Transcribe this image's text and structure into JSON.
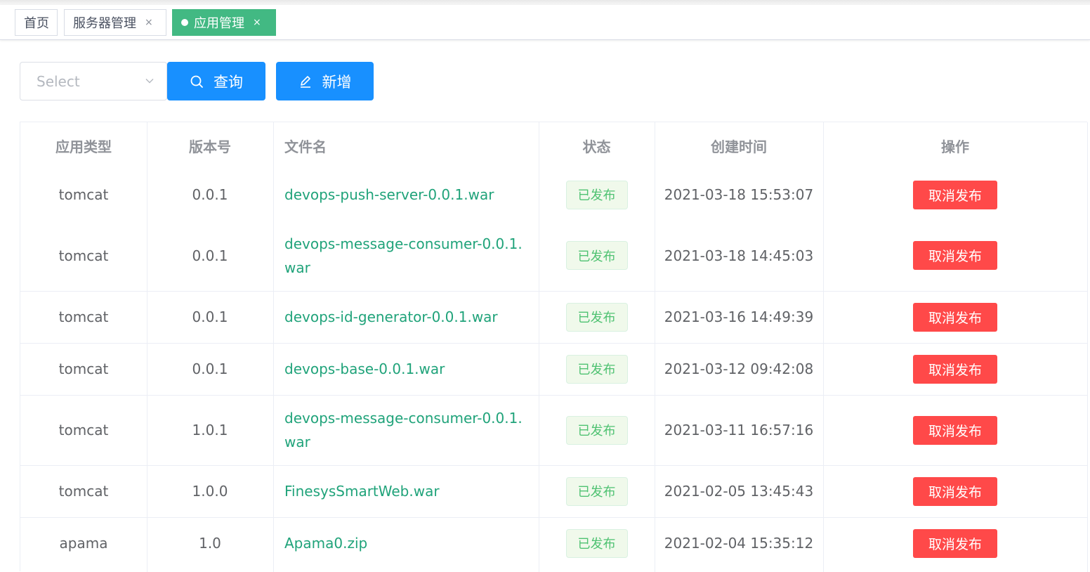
{
  "tags": [
    {
      "label": "首页",
      "closable": false,
      "active": false
    },
    {
      "label": "服务器管理",
      "closable": true,
      "active": false
    },
    {
      "label": "应用管理",
      "closable": true,
      "active": true
    }
  ],
  "close_glyph": "×",
  "toolbar": {
    "select_placeholder": "Select",
    "search_label": "查询",
    "add_label": "新增"
  },
  "table": {
    "headers": {
      "type": "应用类型",
      "version": "版本号",
      "filename": "文件名",
      "status": "状态",
      "created": "创建时间",
      "action": "操作"
    },
    "rows": [
      {
        "type": "tomcat",
        "version": "0.0.1",
        "filename": "devops-push-server-0.0.1.war",
        "status": "已发布",
        "created": "2021-03-18 15:53:07",
        "action": "取消发布"
      },
      {
        "type": "tomcat",
        "version": "0.0.1",
        "filename": "devops-message-consumer-0.0.1.war",
        "status": "已发布",
        "created": "2021-03-18 14:45:03",
        "action": "取消发布"
      },
      {
        "type": "tomcat",
        "version": "0.0.1",
        "filename": "devops-id-generator-0.0.1.war",
        "status": "已发布",
        "created": "2021-03-16 14:49:39",
        "action": "取消发布"
      },
      {
        "type": "tomcat",
        "version": "0.0.1",
        "filename": "devops-base-0.0.1.war",
        "status": "已发布",
        "created": "2021-03-12 09:42:08",
        "action": "取消发布"
      },
      {
        "type": "tomcat",
        "version": "1.0.1",
        "filename": "devops-message-consumer-0.0.1.war",
        "status": "已发布",
        "created": "2021-03-11 16:57:16",
        "action": "取消发布"
      },
      {
        "type": "tomcat",
        "version": "1.0.0",
        "filename": "FinesysSmartWeb.war",
        "status": "已发布",
        "created": "2021-02-05 13:45:43",
        "action": "取消发布"
      },
      {
        "type": "apama",
        "version": "1.0",
        "filename": "Apama0.zip",
        "status": "已发布",
        "created": "2021-02-04 15:35:12",
        "action": "取消发布"
      }
    ]
  },
  "colors": {
    "primary": "#1890ff",
    "active_tag": "#42b983",
    "danger": "#ff4949",
    "link": "#20a37a",
    "success_badge_text": "#4fc272"
  },
  "icons": {
    "search": "search-icon",
    "add": "edit-icon",
    "select_arrow": "chevron-down-icon"
  }
}
